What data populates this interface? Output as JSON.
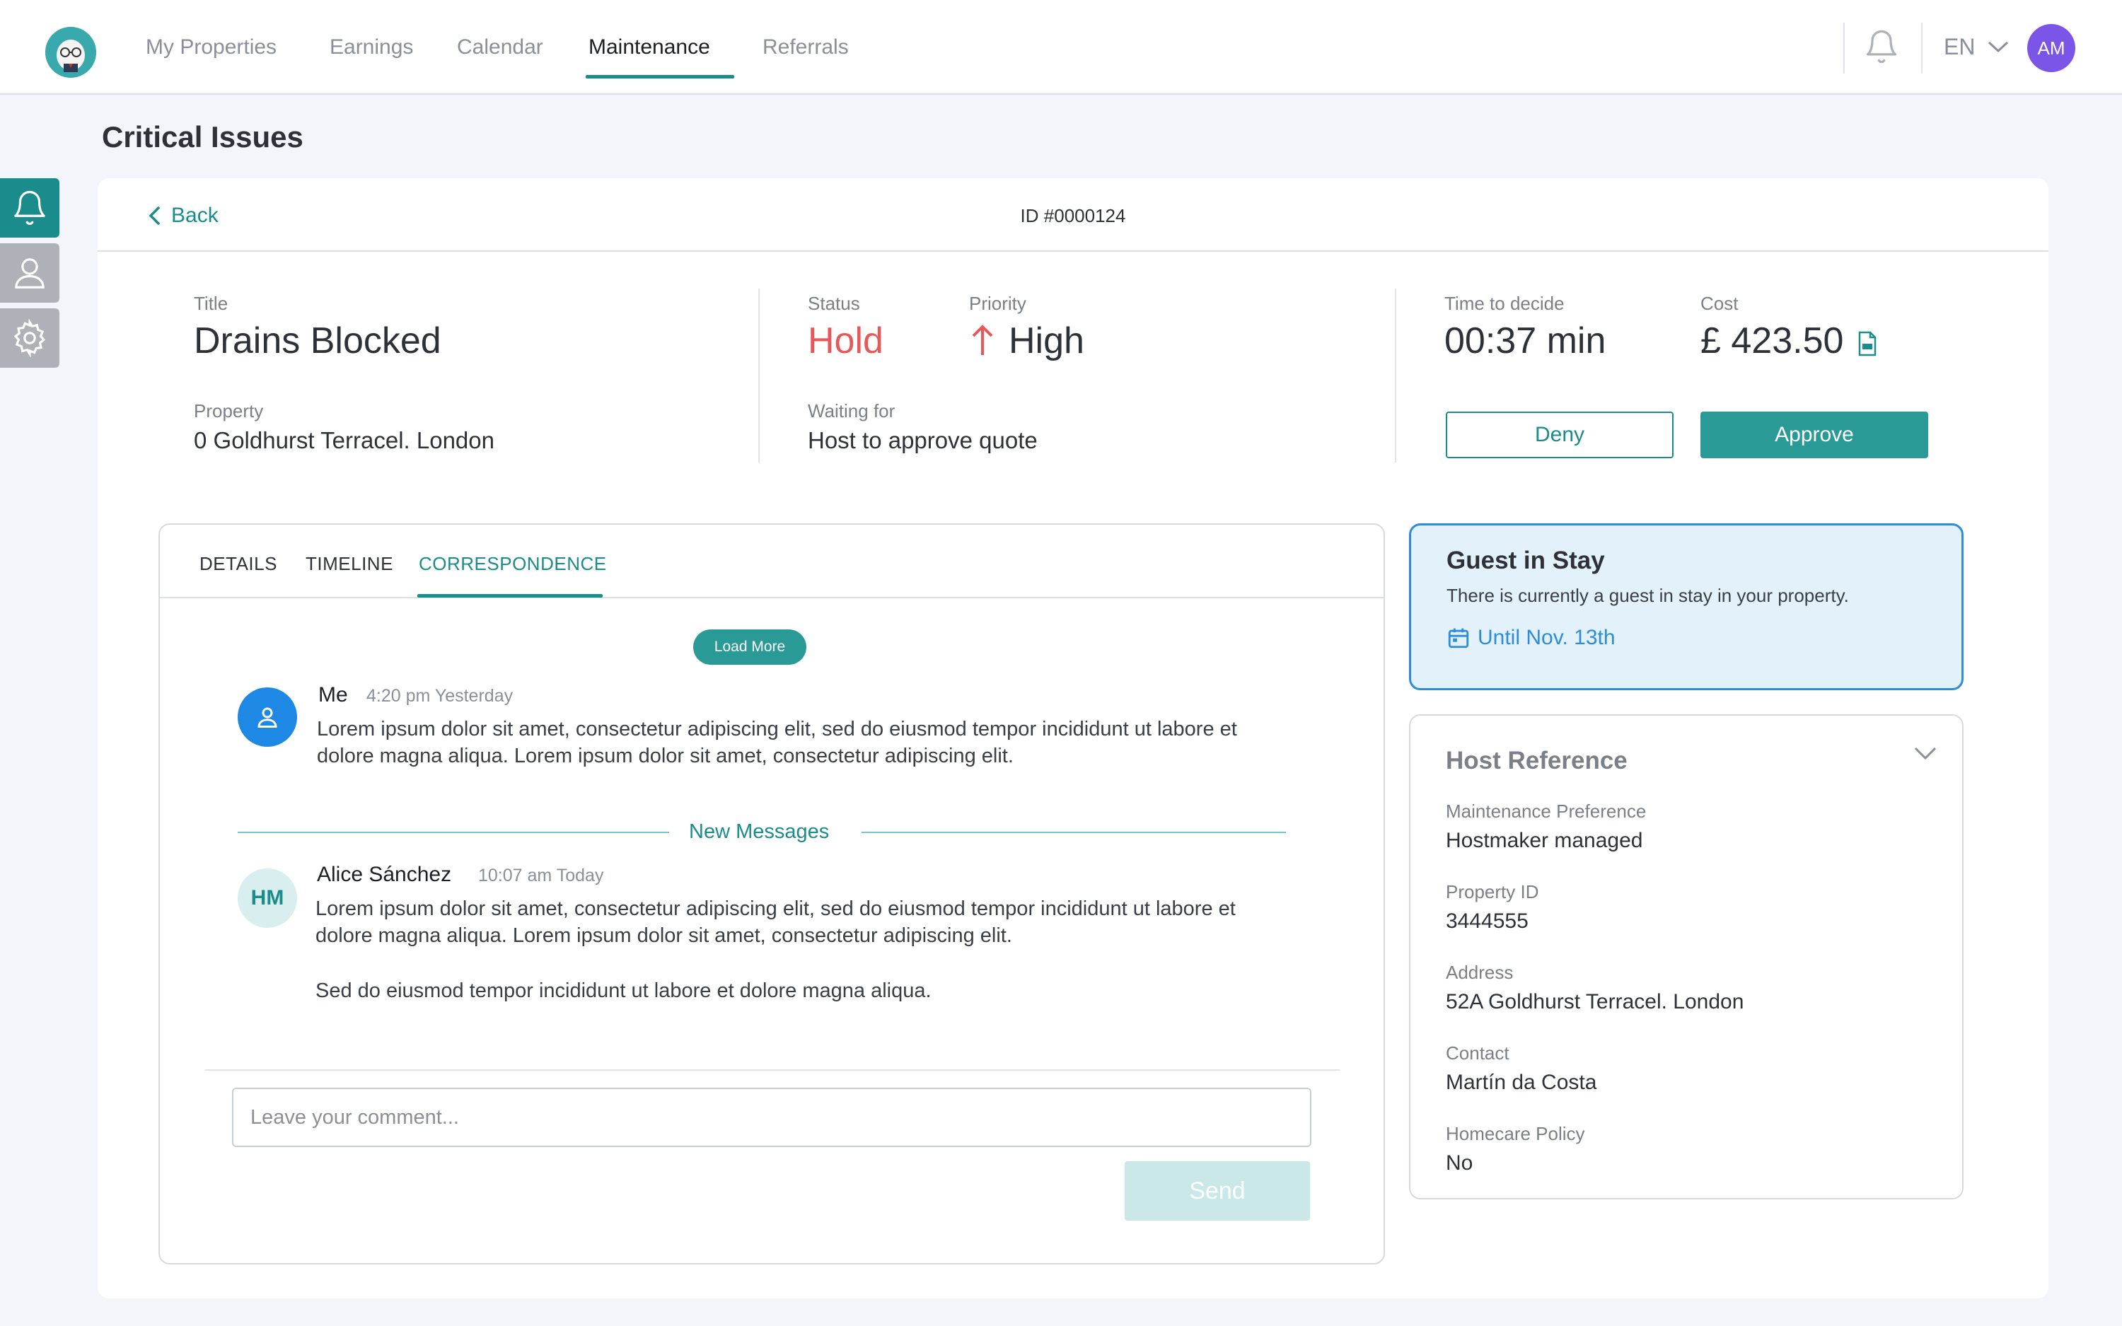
{
  "nav": {
    "items": [
      "My Properties",
      "Earnings",
      "Calendar",
      "Maintenance",
      "Referrals"
    ],
    "active": "Maintenance",
    "language": "EN",
    "user_initials": "AM"
  },
  "page": {
    "title": "Critical Issues"
  },
  "side_rail": {
    "icons": [
      "bell-icon",
      "user-icon",
      "gear-icon"
    ],
    "active": "bell-icon"
  },
  "issue": {
    "back_label": "Back",
    "id": "ID #0000124",
    "title_label": "Title",
    "title": "Drains Blocked",
    "property_label": "Property",
    "property": "0 Goldhurst Terracel. London",
    "status_label": "Status",
    "status": "Hold",
    "priority_label": "Priority",
    "priority": "High",
    "waiting_label": "Waiting for",
    "waiting": "Host to approve quote",
    "time_label": "Time to decide",
    "time": "00:37 min",
    "cost_label": "Cost",
    "cost": "£ 423.50",
    "deny_label": "Deny",
    "approve_label": "Approve"
  },
  "colors": {
    "accent": "#1a8c8b",
    "status_hold": "#e45a5a",
    "guest_blue": "#2d8dd8",
    "avatar_purple": "#7b55e8"
  },
  "tabs": {
    "labels": [
      "DETAILS",
      "TIMELINE",
      "CORRESPONDENCE"
    ],
    "active": "CORRESPONDENCE"
  },
  "correspondence": {
    "load_more": "Load More",
    "messages": [
      {
        "author": "Me",
        "time": "4:20 pm Yesterday",
        "paragraphs": [
          "Lorem ipsum dolor sit amet, consectetur adipiscing elit, sed do eiusmod tempor incididunt ut labore et dolore magna aliqua. Lorem ipsum dolor sit amet, consectetur adipiscing elit."
        ]
      },
      {
        "author": "Alice Sánchez",
        "initials": "HM",
        "time": "10:07 am Today",
        "paragraphs": [
          "Lorem ipsum dolor sit amet, consectetur adipiscing elit, sed do eiusmod tempor incididunt ut labore et dolore magna aliqua. Lorem ipsum dolor sit amet, consectetur adipiscing elit.",
          "Sed do eiusmod tempor incididunt ut labore et dolore magna aliqua."
        ]
      }
    ],
    "new_messages_label": "New Messages",
    "comment_placeholder": "Leave your comment...",
    "send_label": "Send"
  },
  "guest": {
    "title": "Guest in Stay",
    "text": "There is currently a guest in stay in your property.",
    "until": "Until Nov. 13th"
  },
  "host_reference": {
    "title": "Host Reference",
    "fields": [
      {
        "label": "Maintenance Preference",
        "value": "Hostmaker managed"
      },
      {
        "label": "Property ID",
        "value": "3444555"
      },
      {
        "label": "Address",
        "value": "52A Goldhurst Terracel. London"
      },
      {
        "label": "Contact",
        "value": "Martín da Costa"
      },
      {
        "label": "Homecare Policy",
        "value": "No"
      }
    ]
  }
}
